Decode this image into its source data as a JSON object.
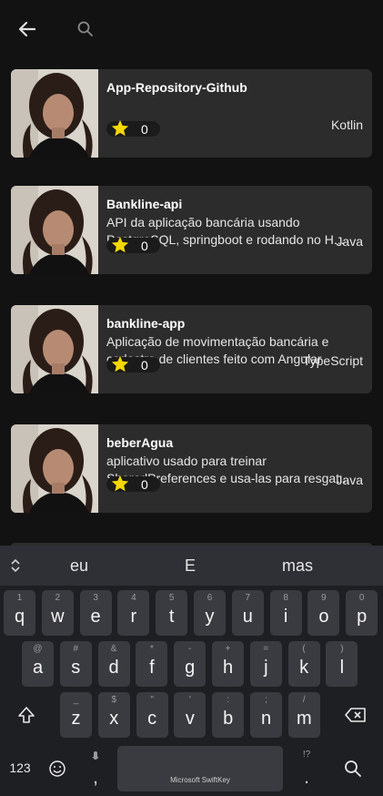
{
  "header": {
    "back_icon": "arrow-back-icon",
    "search_icon": "search-icon"
  },
  "repos": [
    {
      "name": "App-Repository-Github",
      "description": [
        "",
        ""
      ],
      "stars": "0",
      "language": "Kotlin"
    },
    {
      "name": "Bankline-api",
      "description": [
        "API da aplicação bancária usando",
        "PostgreSQL, springboot e rodando no H..."
      ],
      "stars": "0",
      "language": "Java"
    },
    {
      "name": "bankline-app",
      "description": [
        "Aplicação de movimentação bancária e",
        "cadastro de clientes feito com Angular"
      ],
      "stars": "0",
      "language": "TypeScript"
    },
    {
      "name": "beberAgua",
      "description": [
        "aplicativo usado para treinar",
        "SharedPreferences e usa-las para resgat..."
      ],
      "stars": "0",
      "language": "Java"
    }
  ],
  "colors": {
    "star": "#f5d800",
    "card": "#2c2c2c",
    "background": "#121212"
  },
  "keyboard": {
    "suggestions": [
      "eu",
      "E",
      "mas"
    ],
    "row1": [
      [
        "1",
        "q"
      ],
      [
        "2",
        "w"
      ],
      [
        "3",
        "e"
      ],
      [
        "4",
        "r"
      ],
      [
        "5",
        "t"
      ],
      [
        "6",
        "y"
      ],
      [
        "7",
        "u"
      ],
      [
        "8",
        "i"
      ],
      [
        "9",
        "o"
      ],
      [
        "0",
        "p"
      ]
    ],
    "row2": [
      [
        "@",
        "a"
      ],
      [
        "#",
        "s"
      ],
      [
        "&",
        "d"
      ],
      [
        "*",
        "f"
      ],
      [
        "-",
        "g"
      ],
      [
        "+",
        "h"
      ],
      [
        "=",
        "j"
      ],
      [
        "(",
        "k"
      ],
      [
        ")",
        "l"
      ]
    ],
    "row3": [
      [
        "_",
        "z"
      ],
      [
        "$",
        "x"
      ],
      [
        "\"",
        "c"
      ],
      [
        "'",
        "v"
      ],
      [
        ":",
        "b"
      ],
      [
        ";",
        "n"
      ],
      [
        "/",
        "m"
      ]
    ],
    "numbers_label": "123",
    "comma": ",",
    "period": ".",
    "period_hint": "!?",
    "space_brand": "Microsoft SwiftKey",
    "icons": {
      "shift": "shift-icon",
      "backspace": "backspace-icon",
      "emoji": "emoji-icon",
      "mic": "mic-icon",
      "search": "search-icon",
      "expand": "expand-icon"
    }
  }
}
